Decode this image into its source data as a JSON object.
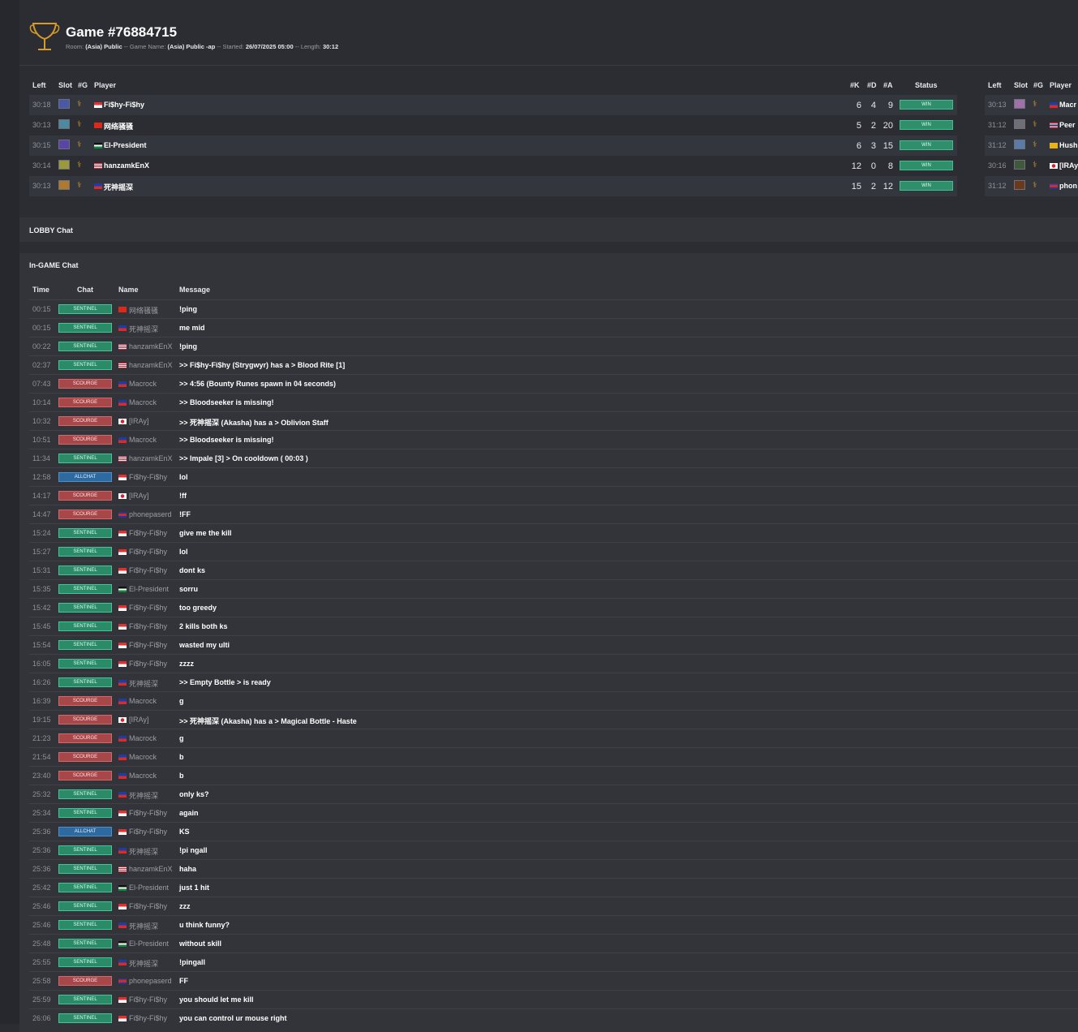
{
  "header": {
    "title": "Game #76884715",
    "room_label": "Room:",
    "room": "(Asia) Public",
    "game_name_label": "Game Name:",
    "game_name": "(Asia) Public -ap",
    "started_label": "Started:",
    "started": "26/07/2025 05:00",
    "length_label": "Length:",
    "length": "30:12",
    "separator": "--"
  },
  "team_a": {
    "headers": {
      "left": "Left",
      "slot": "Slot",
      "g": "#G",
      "player": "Player",
      "k": "#K",
      "d": "#D",
      "a": "#A",
      "status": "Status"
    },
    "players": [
      {
        "left": "30:18",
        "slot_color": "#4a58a8",
        "flag": "f-sg",
        "name": "Fi$hy-Fi$hy",
        "k": "6",
        "d": "4",
        "a": "9",
        "status": "WIN"
      },
      {
        "left": "30:13",
        "slot_color": "#4d8aa0",
        "flag": "f-vn",
        "name": "网络骚骚",
        "k": "5",
        "d": "2",
        "a": "20",
        "status": "WIN"
      },
      {
        "left": "30:15",
        "slot_color": "#5a44a8",
        "flag": "f-jo",
        "name": "El-President",
        "k": "6",
        "d": "3",
        "a": "15",
        "status": "WIN"
      },
      {
        "left": "30:14",
        "slot_color": "#9a9a3a",
        "flag": "f-us",
        "name": "hanzamkEnX",
        "k": "12",
        "d": "0",
        "a": "8",
        "status": "WIN"
      },
      {
        "left": "30:13",
        "slot_color": "#b07a2e",
        "flag": "f-ph",
        "name": "死神摇深",
        "k": "15",
        "d": "2",
        "a": "12",
        "status": "WIN"
      }
    ]
  },
  "team_b": {
    "headers": {
      "left": "Left",
      "slot": "Slot",
      "g": "#G",
      "player": "Player"
    },
    "players": [
      {
        "left": "30:13",
        "slot_color": "#a070a8",
        "flag": "f-ph",
        "name": "Macr"
      },
      {
        "left": "31:12",
        "slot_color": "#6e7076",
        "flag": "f-th",
        "name": "Peer"
      },
      {
        "left": "31:12",
        "slot_color": "#5a7aa8",
        "flag": "f-lk",
        "name": "Hush"
      },
      {
        "left": "30:16",
        "slot_color": "#3e5a3a",
        "flag": "f-jp",
        "name": "[IRAy]"
      },
      {
        "left": "31:12",
        "slot_color": "#6a3a1a",
        "flag": "f-kh",
        "name": "phon"
      }
    ]
  },
  "lobby": {
    "title": "LOBBY Chat"
  },
  "ingame": {
    "title": "In-GAME Chat",
    "headers": {
      "time": "Time",
      "chat": "Chat",
      "name": "Name",
      "message": "Message"
    },
    "rows": [
      {
        "time": "00:15",
        "chat": "SENTINEL",
        "type": "sentinel",
        "flag": "f-vn",
        "name": "网络骚骚",
        "message": "!ping"
      },
      {
        "time": "00:15",
        "chat": "SENTINEL",
        "type": "sentinel",
        "flag": "f-ph",
        "name": "死神摇深",
        "message": "me mid"
      },
      {
        "time": "00:22",
        "chat": "SENTINEL",
        "type": "sentinel",
        "flag": "f-us",
        "name": "hanzamkEnX",
        "message": "!ping"
      },
      {
        "time": "02:37",
        "chat": "SENTINEL",
        "type": "sentinel",
        "flag": "f-us",
        "name": "hanzamkEnX",
        "message": ">> Fi$hy-Fi$hy (Strygwyr) has a > Blood Rite [1]"
      },
      {
        "time": "07:43",
        "chat": "SCOURGE",
        "type": "scourge",
        "flag": "f-ph",
        "name": "Macrock",
        "message": ">> 4:56 (Bounty Runes spawn in 04 seconds)"
      },
      {
        "time": "10:14",
        "chat": "SCOURGE",
        "type": "scourge",
        "flag": "f-ph",
        "name": "Macrock",
        "message": ">> Bloodseeker is missing!"
      },
      {
        "time": "10:32",
        "chat": "SCOURGE",
        "type": "scourge",
        "flag": "f-jp",
        "name": "[IRAy]",
        "message": ">> 死神摇深 (Akasha) has a > Oblivion Staff"
      },
      {
        "time": "10:51",
        "chat": "SCOURGE",
        "type": "scourge",
        "flag": "f-ph",
        "name": "Macrock",
        "message": ">> Bloodseeker is missing!"
      },
      {
        "time": "11:34",
        "chat": "SENTINEL",
        "type": "sentinel",
        "flag": "f-us",
        "name": "hanzamkEnX",
        "message": ">> Impale [3] > On cooldown ( 00:03 )"
      },
      {
        "time": "12:58",
        "chat": "ALLCHAT",
        "type": "allchat",
        "flag": "f-sg",
        "name": "Fi$hy-Fi$hy",
        "message": "lol"
      },
      {
        "time": "14:17",
        "chat": "SCOURGE",
        "type": "scourge",
        "flag": "f-jp",
        "name": "[IRAy]",
        "message": "!ff"
      },
      {
        "time": "14:47",
        "chat": "SCOURGE",
        "type": "scourge",
        "flag": "f-kh",
        "name": "phonepaserd",
        "message": "!FF"
      },
      {
        "time": "15:24",
        "chat": "SENTINEL",
        "type": "sentinel",
        "flag": "f-sg",
        "name": "Fi$hy-Fi$hy",
        "message": "give me the kill"
      },
      {
        "time": "15:27",
        "chat": "SENTINEL",
        "type": "sentinel",
        "flag": "f-sg",
        "name": "Fi$hy-Fi$hy",
        "message": "lol"
      },
      {
        "time": "15:31",
        "chat": "SENTINEL",
        "type": "sentinel",
        "flag": "f-sg",
        "name": "Fi$hy-Fi$hy",
        "message": "dont ks"
      },
      {
        "time": "15:35",
        "chat": "SENTINEL",
        "type": "sentinel",
        "flag": "f-jo",
        "name": "El-President",
        "message": "sorru"
      },
      {
        "time": "15:42",
        "chat": "SENTINEL",
        "type": "sentinel",
        "flag": "f-sg",
        "name": "Fi$hy-Fi$hy",
        "message": "too greedy"
      },
      {
        "time": "15:45",
        "chat": "SENTINEL",
        "type": "sentinel",
        "flag": "f-sg",
        "name": "Fi$hy-Fi$hy",
        "message": "2 kills both ks"
      },
      {
        "time": "15:54",
        "chat": "SENTINEL",
        "type": "sentinel",
        "flag": "f-sg",
        "name": "Fi$hy-Fi$hy",
        "message": "wasted my ulti"
      },
      {
        "time": "16:05",
        "chat": "SENTINEL",
        "type": "sentinel",
        "flag": "f-sg",
        "name": "Fi$hy-Fi$hy",
        "message": "zzzz"
      },
      {
        "time": "16:26",
        "chat": "SENTINEL",
        "type": "sentinel",
        "flag": "f-ph",
        "name": "死神摇深",
        "message": ">> Empty Bottle > is ready"
      },
      {
        "time": "16:39",
        "chat": "SCOURGE",
        "type": "scourge",
        "flag": "f-ph",
        "name": "Macrock",
        "message": "g"
      },
      {
        "time": "19:15",
        "chat": "SCOURGE",
        "type": "scourge",
        "flag": "f-jp",
        "name": "[IRAy]",
        "message": ">> 死神摇深 (Akasha) has a > Magical Bottle - Haste"
      },
      {
        "time": "21:23",
        "chat": "SCOURGE",
        "type": "scourge",
        "flag": "f-ph",
        "name": "Macrock",
        "message": "g"
      },
      {
        "time": "21:54",
        "chat": "SCOURGE",
        "type": "scourge",
        "flag": "f-ph",
        "name": "Macrock",
        "message": "b"
      },
      {
        "time": "23:40",
        "chat": "SCOURGE",
        "type": "scourge",
        "flag": "f-ph",
        "name": "Macrock",
        "message": "b"
      },
      {
        "time": "25:32",
        "chat": "SENTINEL",
        "type": "sentinel",
        "flag": "f-ph",
        "name": "死神摇深",
        "message": "only ks?"
      },
      {
        "time": "25:34",
        "chat": "SENTINEL",
        "type": "sentinel",
        "flag": "f-sg",
        "name": "Fi$hy-Fi$hy",
        "message": "again"
      },
      {
        "time": "25:36",
        "chat": "ALLCHAT",
        "type": "allchat",
        "flag": "f-sg",
        "name": "Fi$hy-Fi$hy",
        "message": "KS"
      },
      {
        "time": "25:36",
        "chat": "SENTINEL",
        "type": "sentinel",
        "flag": "f-ph",
        "name": "死神摇深",
        "message": "!pi ngall"
      },
      {
        "time": "25:36",
        "chat": "SENTINEL",
        "type": "sentinel",
        "flag": "f-us",
        "name": "hanzamkEnX",
        "message": "haha"
      },
      {
        "time": "25:42",
        "chat": "SENTINEL",
        "type": "sentinel",
        "flag": "f-jo",
        "name": "El-President",
        "message": "just 1 hit"
      },
      {
        "time": "25:46",
        "chat": "SENTINEL",
        "type": "sentinel",
        "flag": "f-sg",
        "name": "Fi$hy-Fi$hy",
        "message": "zzz"
      },
      {
        "time": "25:46",
        "chat": "SENTINEL",
        "type": "sentinel",
        "flag": "f-ph",
        "name": "死神摇深",
        "message": "u think funny?"
      },
      {
        "time": "25:48",
        "chat": "SENTINEL",
        "type": "sentinel",
        "flag": "f-jo",
        "name": "El-President",
        "message": "without skill"
      },
      {
        "time": "25:55",
        "chat": "SENTINEL",
        "type": "sentinel",
        "flag": "f-ph",
        "name": "死神摇深",
        "message": "!pingall"
      },
      {
        "time": "25:58",
        "chat": "SCOURGE",
        "type": "scourge",
        "flag": "f-kh",
        "name": "phonepaserd",
        "message": "FF"
      },
      {
        "time": "25:59",
        "chat": "SENTINEL",
        "type": "sentinel",
        "flag": "f-sg",
        "name": "Fi$hy-Fi$hy",
        "message": "you should let me kill"
      },
      {
        "time": "26:06",
        "chat": "SENTINEL",
        "type": "sentinel",
        "flag": "f-sg",
        "name": "Fi$hy-Fi$hy",
        "message": "you can control ur mouse right"
      }
    ]
  },
  "colors": {
    "sentinel": "#2b8a68",
    "scourge": "#a8474a",
    "allchat": "#2d6aa0",
    "win": "#2f8f6b",
    "trophy": "#d59a2a"
  },
  "icons": {
    "trophy": "trophy-icon",
    "link": "link-icon"
  }
}
